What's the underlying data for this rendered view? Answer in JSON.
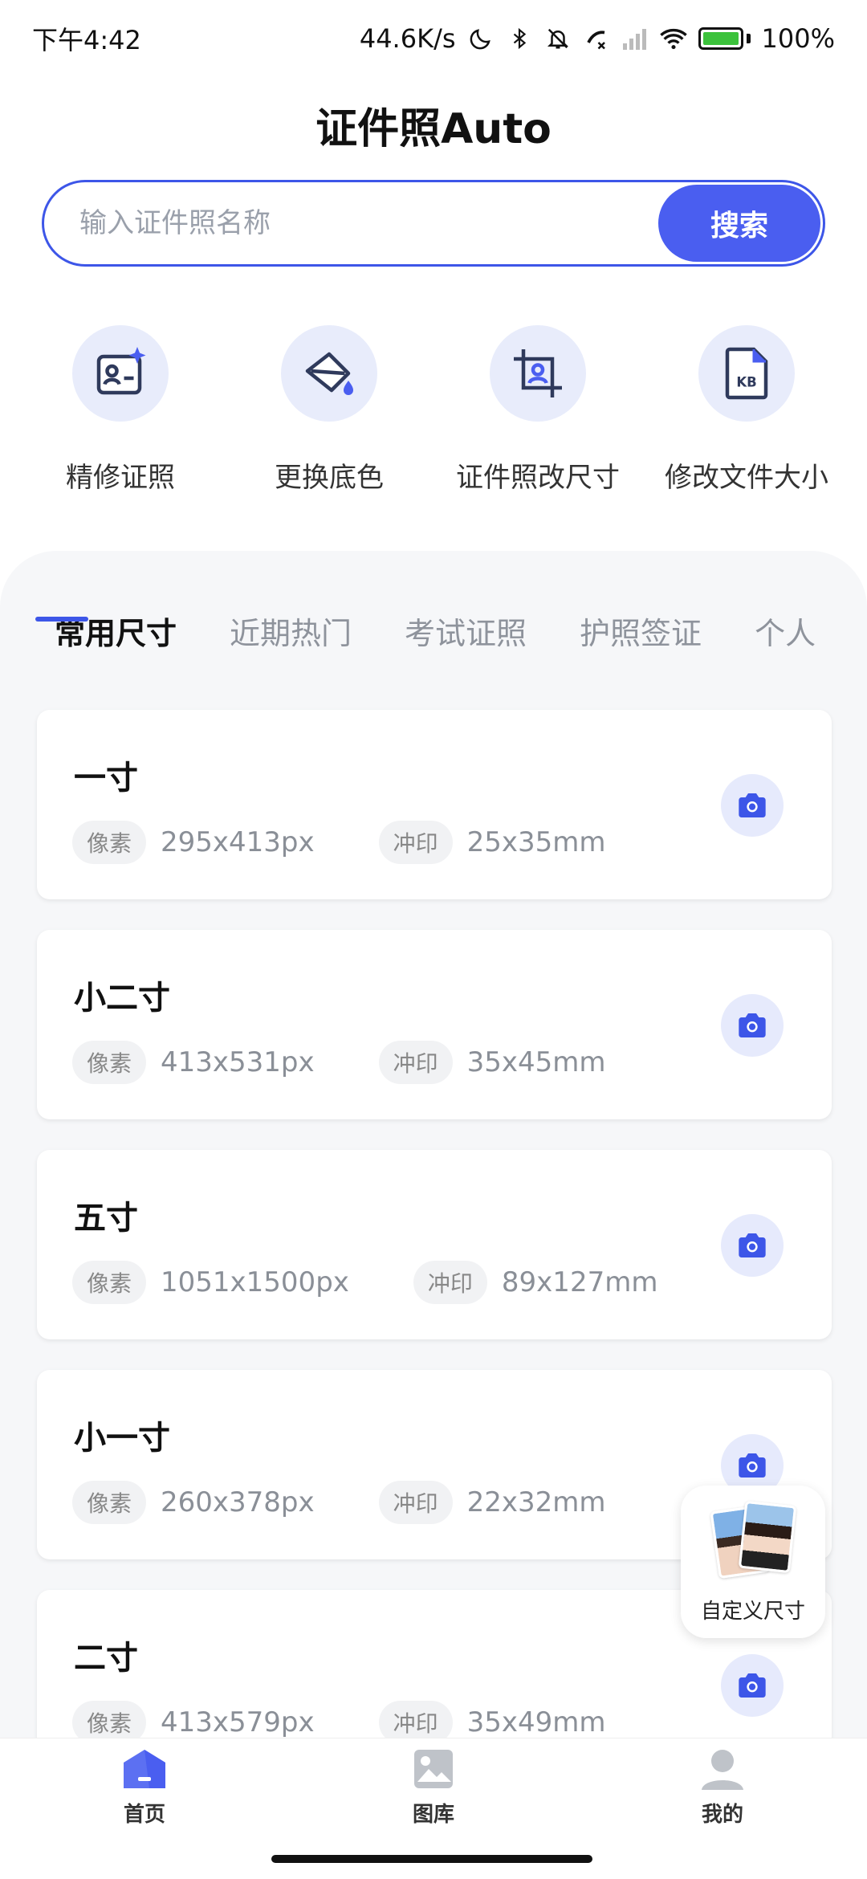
{
  "status_bar": {
    "time": "下午4:42",
    "network_speed": "44.6K/s",
    "battery_percent": "100%",
    "icons": [
      "moon-icon",
      "bluetooth-icon",
      "mute-icon",
      "call-icon",
      "signal-icon",
      "wifi-icon",
      "battery-icon"
    ]
  },
  "header": {
    "title": "证件照Auto"
  },
  "search": {
    "placeholder": "输入证件照名称",
    "button_label": "搜索"
  },
  "tools": [
    {
      "label": "精修证照",
      "icon": "id-card-sparkle-icon"
    },
    {
      "label": "更换底色",
      "icon": "paint-bucket-icon"
    },
    {
      "label": "证件照改尺寸",
      "icon": "crop-portrait-icon"
    },
    {
      "label": "修改文件大小",
      "icon": "kb-file-icon"
    }
  ],
  "tabs": [
    "常用尺寸",
    "近期热门",
    "考试证照",
    "护照签证",
    "个人"
  ],
  "active_tab": "常用尺寸",
  "chip_labels": {
    "pixel": "像素",
    "print": "冲印"
  },
  "sizes": [
    {
      "name": "一寸",
      "pixels": "295x413px",
      "print": "25x35mm"
    },
    {
      "name": "小二寸",
      "pixels": "413x531px",
      "print": "35x45mm"
    },
    {
      "name": "五寸",
      "pixels": "1051x1500px",
      "print": "89x127mm"
    },
    {
      "name": "小一寸",
      "pixels": "260x378px",
      "print": "22x32mm"
    },
    {
      "name": "二寸",
      "pixels": "413x579px",
      "print": "35x49mm"
    }
  ],
  "custom_size": {
    "label": "自定义尺寸"
  },
  "bottom_nav": [
    {
      "label": "首页",
      "icon": "home-icon"
    },
    {
      "label": "图库",
      "icon": "gallery-icon"
    },
    {
      "label": "我的",
      "icon": "profile-icon"
    }
  ],
  "colors": {
    "accent": "#4a5ef0",
    "accent_light": "#e8ecfb"
  }
}
